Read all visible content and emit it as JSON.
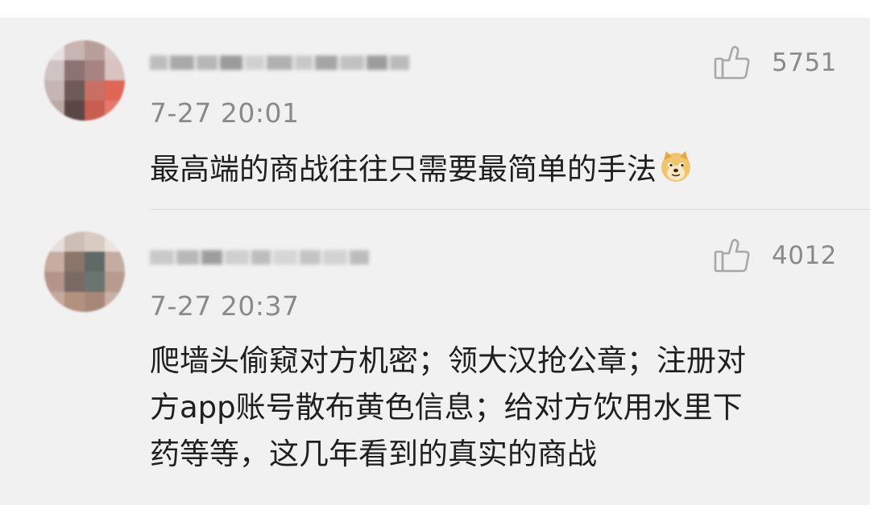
{
  "comments": [
    {
      "username": "你只需要...（已打码）",
      "time": "7-27 20:01",
      "likes": "5751",
      "text_lines": [
        "最高端的商战往往只需要最简单的手法"
      ],
      "emoji": "doge-emoji"
    },
    {
      "username": "...（已打码）",
      "time": "7-27 20:37",
      "likes": "4012",
      "text_lines": [
        "爬墙头偷窥对方机密；领大汉抢公章；注册对",
        "方app账号散布黄色信息；给对方饮用水里下",
        "药等等，这几年看到的真实的商战"
      ]
    }
  ],
  "icons": {
    "like": "thumbs-up-icon",
    "emoji": "doge-emoji"
  },
  "colors": {
    "background": "#f1f1f1",
    "text": "#1f1f1f",
    "meta": "#8a8a8a"
  }
}
